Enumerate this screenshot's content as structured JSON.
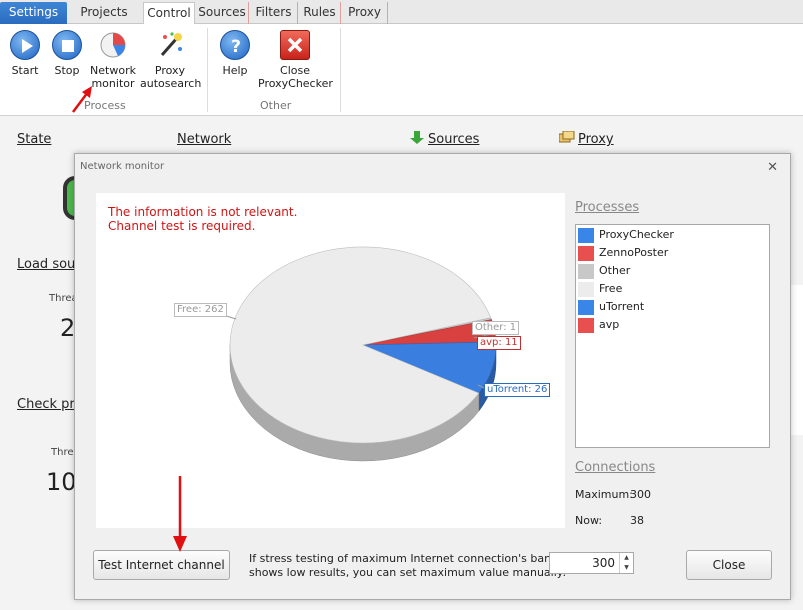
{
  "tabs": [
    "Settings",
    "Projects",
    "Control",
    "Sources",
    "Filters",
    "Rules",
    "Proxy"
  ],
  "ribbon": {
    "start": "Start",
    "stop": "Stop",
    "network_monitor_1": "Network",
    "network_monitor_2": "monitor",
    "proxy_auto_1": "Proxy",
    "proxy_auto_2": "autosearch",
    "help": "Help",
    "close_1": "Close",
    "close_2": "ProxyChecker",
    "group_process": "Process",
    "group_other": "Other"
  },
  "background": {
    "state": "State",
    "network": "Network",
    "sources": "Sources",
    "proxy": "Proxy",
    "load_sources": "Load sou",
    "threads_1": "Threa",
    "value_1": "2",
    "check_proxy": "Check pr",
    "threads_2": "Thre",
    "value_2": "10"
  },
  "dialog": {
    "title": "Network monitor",
    "close_glyph": "✕",
    "warning_1": "The information is not relevant.",
    "warning_2": "Channel test is required.",
    "processes_title": "Processes",
    "connections_title": "Connections",
    "maximum_label": "Maximum:",
    "maximum_value": "300",
    "now_label": "Now:",
    "now_value": "38",
    "test_button": "Test Internet channel",
    "note_1": "If stress testing of maximum Internet connection's bandwidth",
    "note_2": "shows low results, you can set maximum value manually:",
    "spin_value": "300",
    "close_button": "Close"
  },
  "processes": [
    {
      "name": "ProxyChecker",
      "color": "#3a86e8"
    },
    {
      "name": "ZennoPoster",
      "color": "#e85050"
    },
    {
      "name": "Other",
      "color": "#c8c8c8"
    },
    {
      "name": "Free",
      "color": "#ececec"
    },
    {
      "name": "uTorrent",
      "color": "#3a86e8"
    },
    {
      "name": "avp",
      "color": "#e85050"
    }
  ],
  "chart_data": {
    "type": "pie",
    "slices": [
      {
        "label": "Free: 262",
        "name": "Free",
        "value": 262,
        "color": "#ececec"
      },
      {
        "label": "uTorrent: 26",
        "name": "uTorrent",
        "value": 26,
        "color": "#3a7fe0"
      },
      {
        "label": "avp: 11",
        "name": "avp",
        "value": 11,
        "color": "#d94040"
      },
      {
        "label": "Other: 1",
        "name": "Other",
        "value": 1,
        "color": "#c8c8c8"
      }
    ]
  }
}
